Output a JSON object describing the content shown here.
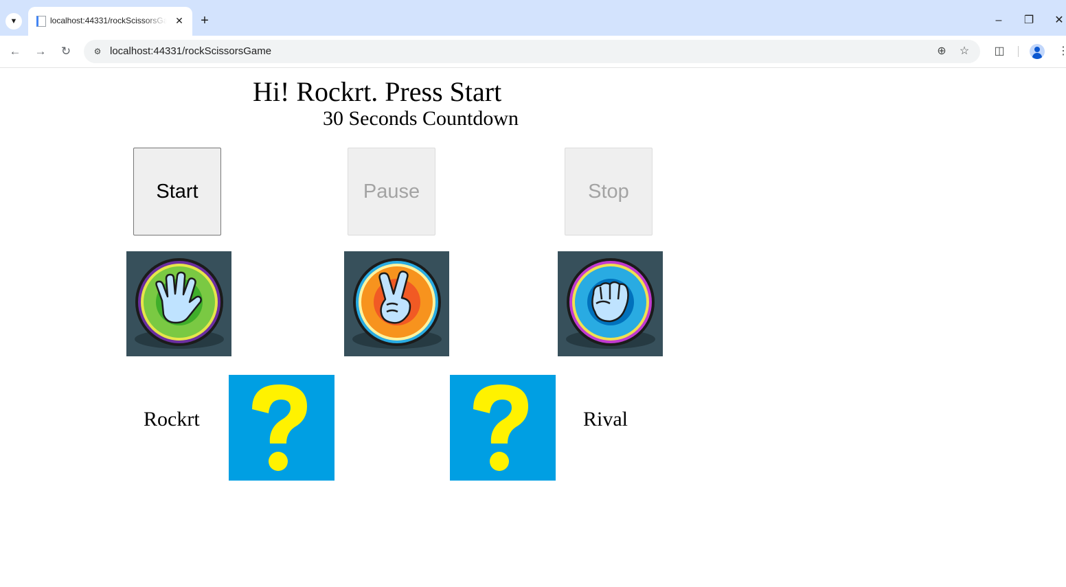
{
  "browser": {
    "tab_title": "localhost:44331/rockScissorsGame",
    "url": "localhost:44331/rockScissorsGame"
  },
  "page": {
    "title": "Hi! Rockrt. Press Start",
    "subtitle": "30 Seconds Countdown"
  },
  "controls": {
    "start_label": "Start",
    "pause_label": "Pause",
    "stop_label": "Stop",
    "pause_disabled": true,
    "stop_disabled": true
  },
  "hands": [
    {
      "name": "paper",
      "icon": "paper-hand-icon",
      "ring_color": "#7ac943"
    },
    {
      "name": "scissors",
      "icon": "scissors-hand-icon",
      "ring_color": "#f7931e"
    },
    {
      "name": "rock",
      "icon": "rock-hand-icon",
      "ring_color": "#29abe2"
    }
  ],
  "players": {
    "player_name": "Rockrt",
    "rival_name": "Rival",
    "player_choice_icon": "question-mark-icon",
    "rival_choice_icon": "question-mark-icon"
  },
  "colors": {
    "hand_card_bg": "#37505b",
    "mystery_bg": "#009fe3",
    "question_mark": "#fff200"
  }
}
